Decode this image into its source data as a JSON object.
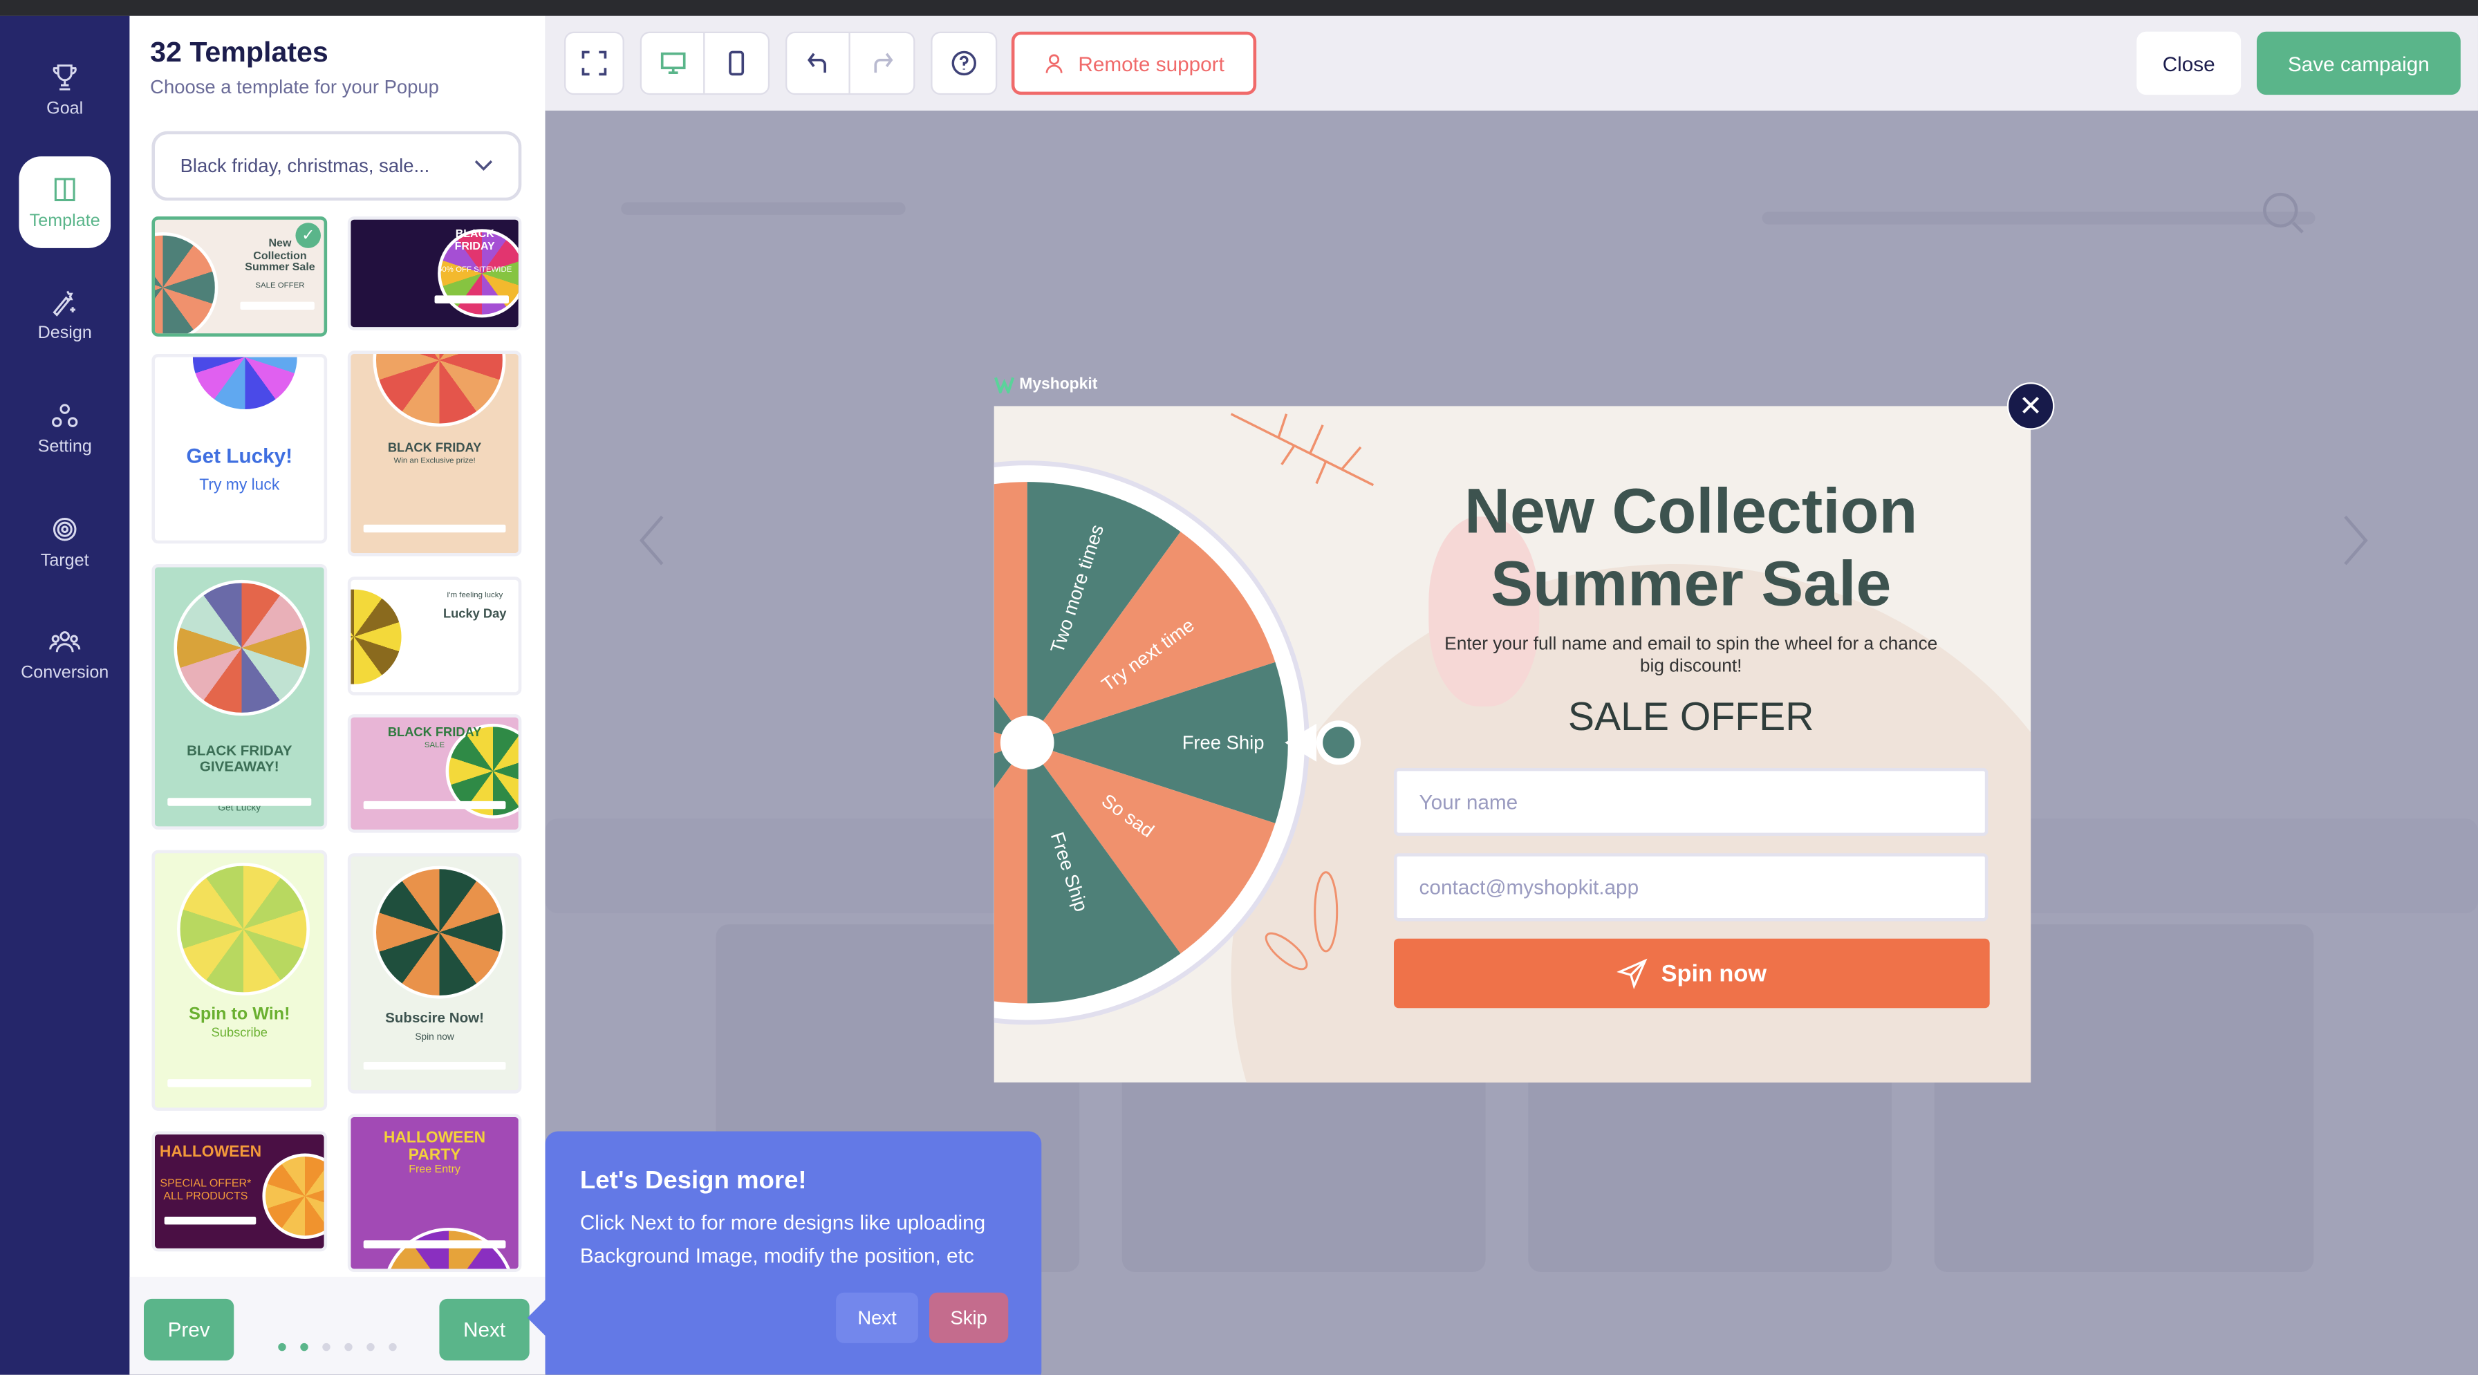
{
  "sidebar": {
    "items": [
      {
        "label": "Goal",
        "icon": "trophy-icon"
      },
      {
        "label": "Template",
        "icon": "template-icon",
        "active": true
      },
      {
        "label": "Design",
        "icon": "magic-wand-icon"
      },
      {
        "label": "Setting",
        "icon": "settings-icon"
      },
      {
        "label": "Target",
        "icon": "target-icon"
      },
      {
        "label": "Conversion",
        "icon": "users-icon"
      }
    ]
  },
  "panel": {
    "title": "32 Templates",
    "subtitle": "Choose a template for your Popup",
    "dropdown_value": "Black friday, christmas, sale...",
    "templates": [
      {
        "title": "New Collection Summer Sale",
        "sub": "SALE OFFER",
        "bg": "#f4ece6",
        "selected": true
      },
      {
        "title": "BLACK FRIDAY",
        "sub": "50% OFF SITEWIDE",
        "bg": "#22103e"
      },
      {
        "title": "Get Lucky!",
        "sub": "Try my luck",
        "bg": "#ffffff"
      },
      {
        "title": "BLACK FRIDAY",
        "sub": "Win an Exclusive prize!",
        "bg": "#f3d8bd"
      },
      {
        "title": "BLACK FRIDAY GIVEAWAY!",
        "sub": "Get Lucky",
        "bg": "#b3e0c9"
      },
      {
        "title": "Lucky Day",
        "sub": "I'm feeling lucky",
        "bg": "#ffffff"
      },
      {
        "title": "BLACK FRIDAY",
        "sub": "SALE",
        "bg": "#e8b5d6"
      },
      {
        "title": "Spin to Win!",
        "sub": "Subscribe",
        "bg": "#f1fbd9"
      },
      {
        "title": "Subscire Now!",
        "sub": "Spin now",
        "bg": "#eef3ea"
      },
      {
        "title": "HALLOWEEN",
        "sub": "SPECIAL OFFER* ALL PRODUCTS",
        "bg": "#4a0f44"
      },
      {
        "title": "HALLOWEEN PARTY",
        "sub": "Free Entry",
        "bg": "#a24ab5"
      }
    ],
    "prev_label": "Prev",
    "next_label": "Next",
    "pagination": {
      "total": 6,
      "current": 2
    }
  },
  "toolbar": {
    "remote_support": "Remote support",
    "close": "Close",
    "save": "Save campaign"
  },
  "popup": {
    "brand": "Myshopkit",
    "title_line1": "New Collection",
    "title_line2": "Summer Sale",
    "description": "Enter your full name and email to spin the wheel for a chance big discount!",
    "offer": "SALE OFFER",
    "name_placeholder": "Your name",
    "email_placeholder": "contact@myshopkit.app",
    "button": "Spin now",
    "wheel_segments": [
      {
        "label": "Free Ship",
        "color": "#4e8078"
      },
      {
        "label": "So sad",
        "color": "#f0916d"
      },
      {
        "label": "Free Ship",
        "color": "#4e8078"
      },
      {
        "label": "",
        "color": "#f0916d"
      },
      {
        "label": "",
        "color": "#4e8078"
      },
      {
        "label": "",
        "color": "#f0916d"
      },
      {
        "label": "",
        "color": "#4e8078"
      },
      {
        "label": "",
        "color": "#f0916d"
      },
      {
        "label": "Two more times",
        "color": "#4e8078"
      },
      {
        "label": "Try next time",
        "color": "#f0916d"
      }
    ]
  },
  "tour": {
    "title": "Let's Design more!",
    "body": "Click Next to for more designs like uploading Background Image, modify the position, etc",
    "next": "Next",
    "skip": "Skip"
  },
  "colors": {
    "accent": "#5ab58a",
    "sidebar": "#25266a",
    "danger": "#f06a6a",
    "cta": "#ef7249",
    "tour": "#6379e6"
  }
}
